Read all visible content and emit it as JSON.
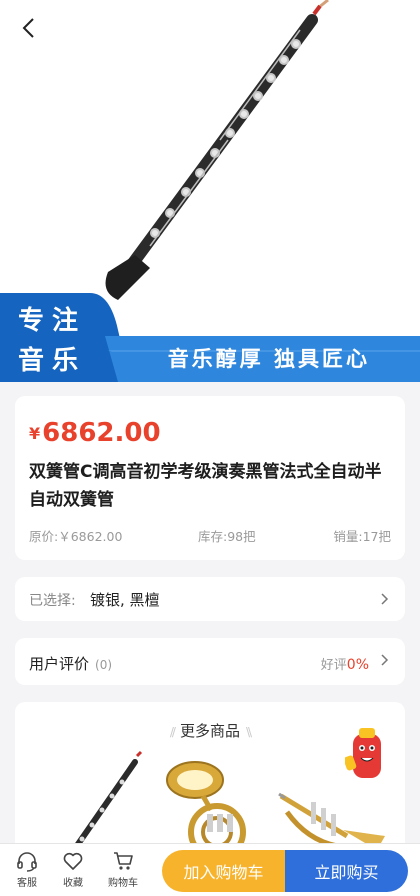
{
  "banner": {
    "slogan_line1": "专注",
    "slogan_line2": "音乐",
    "tagline": "音乐醇厚  独具匠心",
    "colors": {
      "primary": "#1565c0",
      "secondary": "#2f86dd"
    }
  },
  "product": {
    "currency": "¥",
    "price": "6862.00",
    "title": "双簧管C调高音初学考级演奏黑管法式全自动半自动双簧管",
    "original_price": "原价:￥6862.00",
    "stock": "库存:98把",
    "sales": "销量:17把"
  },
  "selection": {
    "label": "已选择:",
    "value": "镀银, 黑檀"
  },
  "reviews": {
    "label": "用户评价",
    "count": "(0)",
    "good_rate_label": "好评",
    "good_rate_value": "0%"
  },
  "more_products": {
    "title": "更多商品",
    "items": [
      "oboe",
      "french-horn",
      "trumpet"
    ]
  },
  "bottom_bar": {
    "service": "客服",
    "favorite": "收藏",
    "cart": "购物车",
    "add_to_cart": "加入购物车",
    "buy_now": "立即购买",
    "colors": {
      "add_to_cart": "#f7b32b",
      "buy_now": "#2f6fdb"
    }
  },
  "accent_color": "#e8412c"
}
